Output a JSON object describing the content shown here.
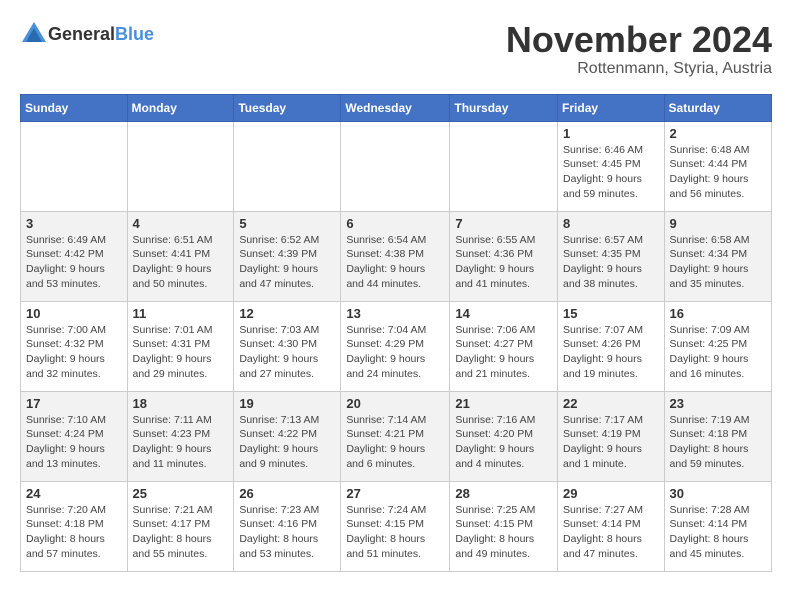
{
  "header": {
    "logo_general": "General",
    "logo_blue": "Blue",
    "month_title": "November 2024",
    "subtitle": "Rottenmann, Styria, Austria"
  },
  "weekdays": [
    "Sunday",
    "Monday",
    "Tuesday",
    "Wednesday",
    "Thursday",
    "Friday",
    "Saturday"
  ],
  "weeks": [
    [
      {
        "day": "",
        "info": ""
      },
      {
        "day": "",
        "info": ""
      },
      {
        "day": "",
        "info": ""
      },
      {
        "day": "",
        "info": ""
      },
      {
        "day": "",
        "info": ""
      },
      {
        "day": "1",
        "info": "Sunrise: 6:46 AM\nSunset: 4:45 PM\nDaylight: 9 hours and 59 minutes."
      },
      {
        "day": "2",
        "info": "Sunrise: 6:48 AM\nSunset: 4:44 PM\nDaylight: 9 hours and 56 minutes."
      }
    ],
    [
      {
        "day": "3",
        "info": "Sunrise: 6:49 AM\nSunset: 4:42 PM\nDaylight: 9 hours and 53 minutes."
      },
      {
        "day": "4",
        "info": "Sunrise: 6:51 AM\nSunset: 4:41 PM\nDaylight: 9 hours and 50 minutes."
      },
      {
        "day": "5",
        "info": "Sunrise: 6:52 AM\nSunset: 4:39 PM\nDaylight: 9 hours and 47 minutes."
      },
      {
        "day": "6",
        "info": "Sunrise: 6:54 AM\nSunset: 4:38 PM\nDaylight: 9 hours and 44 minutes."
      },
      {
        "day": "7",
        "info": "Sunrise: 6:55 AM\nSunset: 4:36 PM\nDaylight: 9 hours and 41 minutes."
      },
      {
        "day": "8",
        "info": "Sunrise: 6:57 AM\nSunset: 4:35 PM\nDaylight: 9 hours and 38 minutes."
      },
      {
        "day": "9",
        "info": "Sunrise: 6:58 AM\nSunset: 4:34 PM\nDaylight: 9 hours and 35 minutes."
      }
    ],
    [
      {
        "day": "10",
        "info": "Sunrise: 7:00 AM\nSunset: 4:32 PM\nDaylight: 9 hours and 32 minutes."
      },
      {
        "day": "11",
        "info": "Sunrise: 7:01 AM\nSunset: 4:31 PM\nDaylight: 9 hours and 29 minutes."
      },
      {
        "day": "12",
        "info": "Sunrise: 7:03 AM\nSunset: 4:30 PM\nDaylight: 9 hours and 27 minutes."
      },
      {
        "day": "13",
        "info": "Sunrise: 7:04 AM\nSunset: 4:29 PM\nDaylight: 9 hours and 24 minutes."
      },
      {
        "day": "14",
        "info": "Sunrise: 7:06 AM\nSunset: 4:27 PM\nDaylight: 9 hours and 21 minutes."
      },
      {
        "day": "15",
        "info": "Sunrise: 7:07 AM\nSunset: 4:26 PM\nDaylight: 9 hours and 19 minutes."
      },
      {
        "day": "16",
        "info": "Sunrise: 7:09 AM\nSunset: 4:25 PM\nDaylight: 9 hours and 16 minutes."
      }
    ],
    [
      {
        "day": "17",
        "info": "Sunrise: 7:10 AM\nSunset: 4:24 PM\nDaylight: 9 hours and 13 minutes."
      },
      {
        "day": "18",
        "info": "Sunrise: 7:11 AM\nSunset: 4:23 PM\nDaylight: 9 hours and 11 minutes."
      },
      {
        "day": "19",
        "info": "Sunrise: 7:13 AM\nSunset: 4:22 PM\nDaylight: 9 hours and 9 minutes."
      },
      {
        "day": "20",
        "info": "Sunrise: 7:14 AM\nSunset: 4:21 PM\nDaylight: 9 hours and 6 minutes."
      },
      {
        "day": "21",
        "info": "Sunrise: 7:16 AM\nSunset: 4:20 PM\nDaylight: 9 hours and 4 minutes."
      },
      {
        "day": "22",
        "info": "Sunrise: 7:17 AM\nSunset: 4:19 PM\nDaylight: 9 hours and 1 minute."
      },
      {
        "day": "23",
        "info": "Sunrise: 7:19 AM\nSunset: 4:18 PM\nDaylight: 8 hours and 59 minutes."
      }
    ],
    [
      {
        "day": "24",
        "info": "Sunrise: 7:20 AM\nSunset: 4:18 PM\nDaylight: 8 hours and 57 minutes."
      },
      {
        "day": "25",
        "info": "Sunrise: 7:21 AM\nSunset: 4:17 PM\nDaylight: 8 hours and 55 minutes."
      },
      {
        "day": "26",
        "info": "Sunrise: 7:23 AM\nSunset: 4:16 PM\nDaylight: 8 hours and 53 minutes."
      },
      {
        "day": "27",
        "info": "Sunrise: 7:24 AM\nSunset: 4:15 PM\nDaylight: 8 hours and 51 minutes."
      },
      {
        "day": "28",
        "info": "Sunrise: 7:25 AM\nSunset: 4:15 PM\nDaylight: 8 hours and 49 minutes."
      },
      {
        "day": "29",
        "info": "Sunrise: 7:27 AM\nSunset: 4:14 PM\nDaylight: 8 hours and 47 minutes."
      },
      {
        "day": "30",
        "info": "Sunrise: 7:28 AM\nSunset: 4:14 PM\nDaylight: 8 hours and 45 minutes."
      }
    ]
  ]
}
